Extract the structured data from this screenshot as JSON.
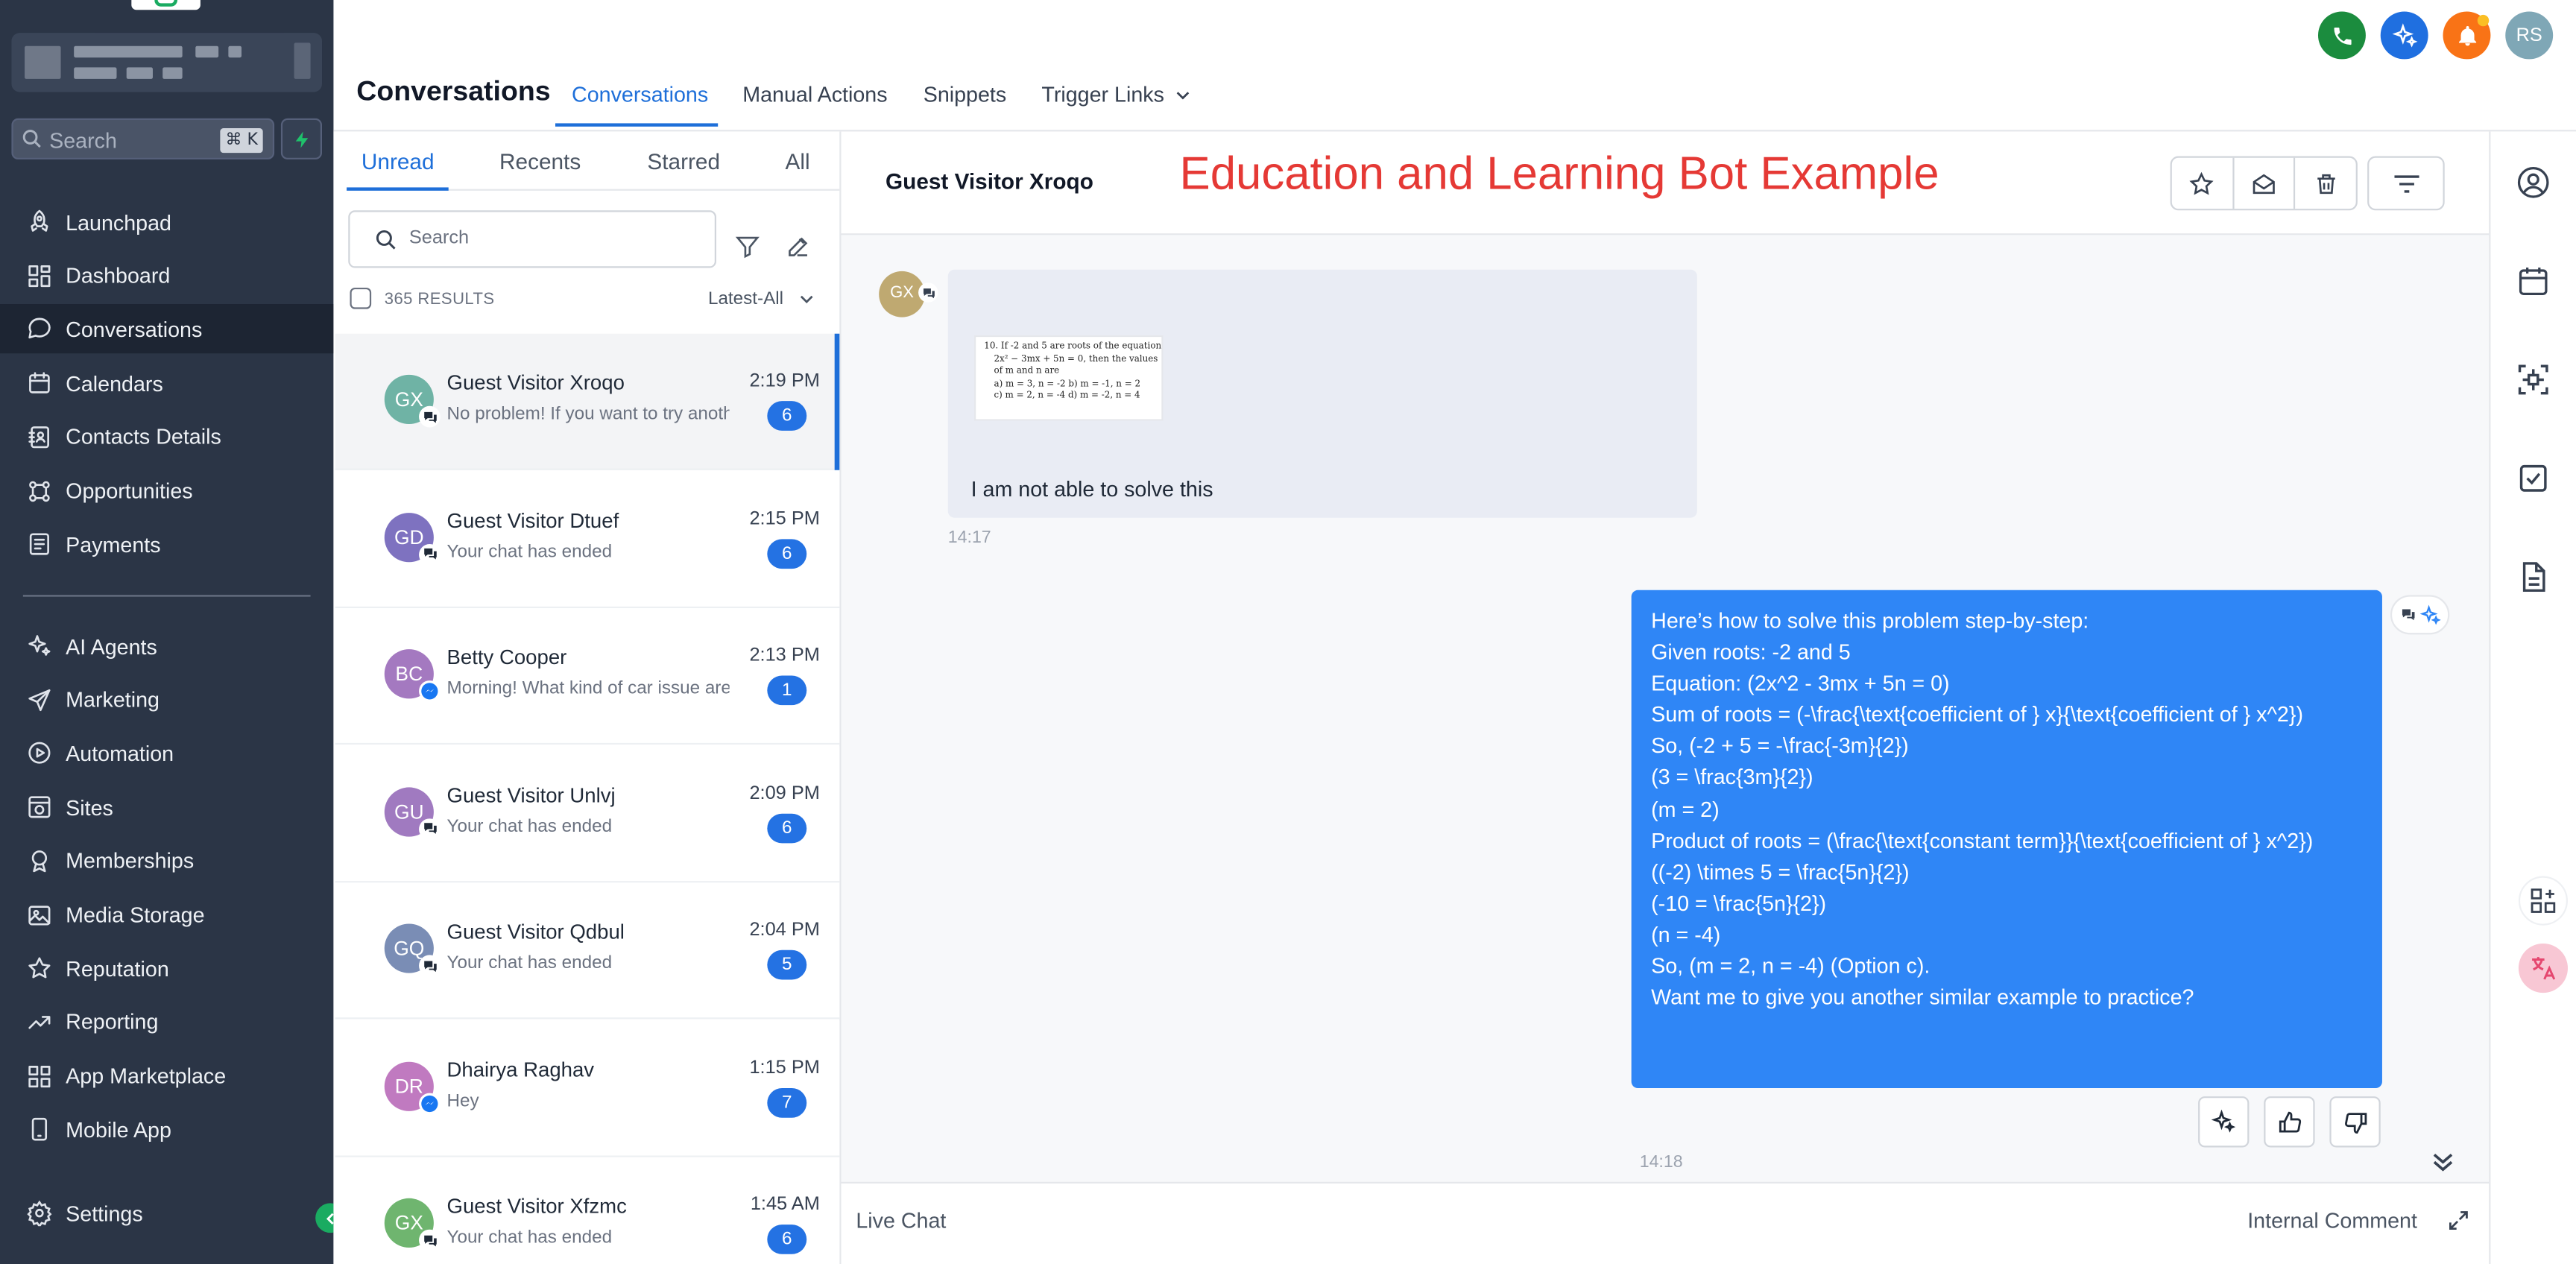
{
  "sidebar": {
    "search_placeholder": "Search",
    "search_shortcut": "⌘ K",
    "nav": [
      {
        "label": "Launchpad",
        "icon": "rocket-icon"
      },
      {
        "label": "Dashboard",
        "icon": "dashboard-icon"
      },
      {
        "label": "Conversations",
        "icon": "chat-bubble-icon",
        "active": true
      },
      {
        "label": "Calendars",
        "icon": "calendar-icon"
      },
      {
        "label": "Contacts Details",
        "icon": "contacts-icon"
      },
      {
        "label": "Opportunities",
        "icon": "opportunities-icon"
      },
      {
        "label": "Payments",
        "icon": "payments-icon"
      }
    ],
    "nav2": [
      {
        "label": "AI Agents",
        "icon": "sparkle-icon"
      },
      {
        "label": "Marketing",
        "icon": "send-icon"
      },
      {
        "label": "Automation",
        "icon": "automation-icon"
      },
      {
        "label": "Sites",
        "icon": "globe-icon"
      },
      {
        "label": "Memberships",
        "icon": "membership-icon"
      },
      {
        "label": "Media Storage",
        "icon": "image-icon"
      },
      {
        "label": "Reputation",
        "icon": "star-icon"
      },
      {
        "label": "Reporting",
        "icon": "trend-icon"
      },
      {
        "label": "App Marketplace",
        "icon": "grid-icon"
      },
      {
        "label": "Mobile App",
        "icon": "mobile-icon"
      }
    ],
    "settings_label": "Settings"
  },
  "header": {
    "title": "Conversations",
    "tabs": [
      "Conversations",
      "Manual Actions",
      "Snippets",
      "Trigger Links"
    ],
    "user_initials": "RS",
    "colors": {
      "phone": "#1b8c3e",
      "ai": "#1f6fe0",
      "bell": "#f97316",
      "avatar": "#7fa7b6"
    }
  },
  "list": {
    "tabs": [
      "Unread",
      "Recents",
      "Starred",
      "All"
    ],
    "search_placeholder": "Search",
    "results": "365 RESULTS",
    "sort": "Latest-All",
    "rows": [
      {
        "initials": "GX",
        "name": "Guest Visitor Xroqo",
        "preview": "No problem! If you want to try another",
        "time": "2:19 PM",
        "count": "6",
        "color": "#6fb3a5",
        "channel": "chat"
      },
      {
        "initials": "GD",
        "name": "Guest Visitor Dtuef",
        "preview": "Your chat has ended",
        "time": "2:15 PM",
        "count": "6",
        "color": "#7e72c0",
        "channel": "chat"
      },
      {
        "initials": "BC",
        "name": "Betty Cooper",
        "preview": "Morning! What kind of car issue are you",
        "time": "2:13 PM",
        "count": "1",
        "color": "#a479c0",
        "channel": "messenger"
      },
      {
        "initials": "GU",
        "name": "Guest Visitor Unlvj",
        "preview": "Your chat has ended",
        "time": "2:09 PM",
        "count": "6",
        "color": "#a07ac0",
        "channel": "chat"
      },
      {
        "initials": "GQ",
        "name": "Guest Visitor Qdbul",
        "preview": "Your chat has ended",
        "time": "2:04 PM",
        "count": "5",
        "color": "#7a8db5",
        "channel": "chat"
      },
      {
        "initials": "DR",
        "name": "Dhairya Raghav",
        "preview": "Hey",
        "time": "1:15 PM",
        "count": "7",
        "color": "#c07ac0",
        "channel": "messenger"
      },
      {
        "initials": "GX",
        "name": "Guest Visitor Xfzmc",
        "preview": "Your chat has ended",
        "time": "1:45 AM",
        "count": "6",
        "color": "#6fb56f",
        "channel": "chat"
      }
    ]
  },
  "chat": {
    "contact": "Guest Visitor Xroqo",
    "banner": "Education and Learning Bot Example",
    "incoming": {
      "initials": "GX",
      "image_text": [
        "10. If -2 and 5 are roots of the equation",
        "2x² − 3mx + 5n = 0, then the values",
        "of m and n are",
        "a) m = 3, n = -2      b) m = -1, n = 2",
        "c) m = 2, n = -4      d) m = -2, n = 4"
      ],
      "text": "I am not able to solve this",
      "time": "14:17"
    },
    "outgoing": {
      "lines": [
        "Here’s how to solve this problem step-by-step:",
        "Given roots: -2 and 5",
        "Equation: (2x^2 - 3mx + 5n = 0)",
        "Sum of roots = (-\\frac{\\text{coefficient of } x}{\\text{coefficient of } x^2})",
        "So, (-2 + 5 = -\\frac{-3m}{2})",
        "(3 = \\frac{3m}{2})",
        "(m = 2)",
        "Product of roots = (\\frac{\\text{constant term}}{\\text{coefficient of } x^2})",
        "((-2) \\times 5 = \\frac{5n}{2})",
        "(-10 = \\frac{5n}{2})",
        "(n = -4)",
        "So, (m = 2, n = -4) (Option c).",
        "Want me to give you another similar example to practice?"
      ],
      "time": "14:18",
      "color": "#2f86f6"
    },
    "composer": {
      "channel": "Live Chat",
      "internal": "Internal Comment"
    }
  }
}
